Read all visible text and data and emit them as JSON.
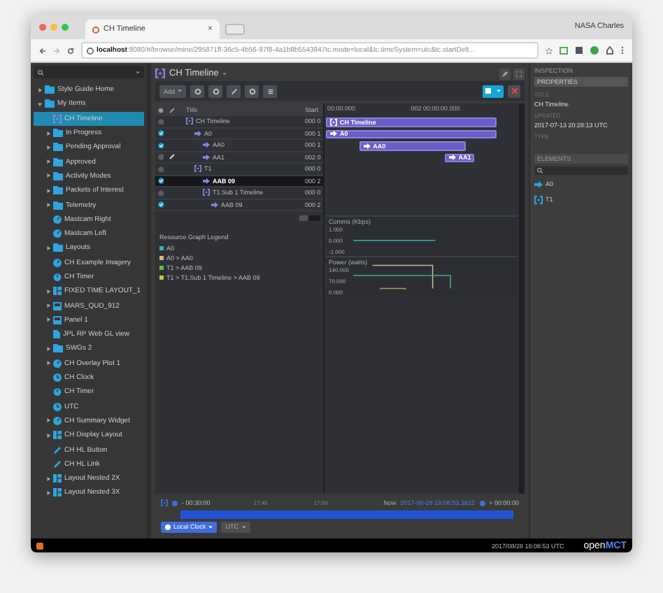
{
  "browser": {
    "tab_title": "CH Timeline",
    "tab_close": "×",
    "profile": "NASA Charles",
    "url_host": "localhost",
    "url_rest": ":8080/#/browse/mine/295871ff-36c5-4b56-97f8-4a1b8b5543947tc.mode=local&tc.timeSystem=utc&tc.startDelt..."
  },
  "sidebar": {
    "items": [
      {
        "label": "Style Guide Home",
        "kind": "folder",
        "expanded": false,
        "selected": false
      },
      {
        "label": "My Items",
        "kind": "folder",
        "expanded": true,
        "selected": false,
        "children": [
          {
            "label": "CH Timeline",
            "kind": "timeline",
            "selected": true
          },
          {
            "label": "In Progress",
            "kind": "folder",
            "expanded": false,
            "selected": false
          },
          {
            "label": "Pending Approval",
            "kind": "folder",
            "expanded": false,
            "selected": false
          },
          {
            "label": "Approved",
            "kind": "folder",
            "expanded": false,
            "selected": false
          },
          {
            "label": "Activity Modes",
            "kind": "folder",
            "expanded": false,
            "selected": false
          },
          {
            "label": "Packets of Interest",
            "kind": "folder",
            "expanded": false,
            "selected": false
          },
          {
            "label": "Telemetry",
            "kind": "folder",
            "expanded": false,
            "selected": false
          },
          {
            "label": "Mastcam Right",
            "kind": "telemetry",
            "selected": false
          },
          {
            "label": "Mastcam Left",
            "kind": "telemetry",
            "selected": false
          },
          {
            "label": "Layouts",
            "kind": "folder",
            "expanded": false,
            "selected": false
          },
          {
            "label": "CH Example Imagery",
            "kind": "telemetry",
            "selected": false
          },
          {
            "label": "CH Timer",
            "kind": "timer",
            "selected": false
          },
          {
            "label": "FIXED TIME LAYOUT_1",
            "kind": "layout",
            "expanded": false,
            "selected": false
          },
          {
            "label": "MARS_QUD_912",
            "kind": "panel",
            "expanded": false,
            "selected": false
          },
          {
            "label": "Panel 1",
            "kind": "panel",
            "expanded": false,
            "selected": false
          },
          {
            "label": "JPL RP Web GL view",
            "kind": "document",
            "selected": false
          },
          {
            "label": "SWGs 2",
            "kind": "folder",
            "expanded": false,
            "selected": false
          },
          {
            "label": "CH Overlay Plot 1",
            "kind": "telemetry",
            "expanded": false,
            "selected": false
          },
          {
            "label": "CH Clock",
            "kind": "clock",
            "selected": false
          },
          {
            "label": "CH Timer",
            "kind": "timer",
            "selected": false
          },
          {
            "label": "UTC",
            "kind": "clock",
            "selected": false
          },
          {
            "label": "CH Summary Widget",
            "kind": "telemetry",
            "expanded": false,
            "selected": false
          },
          {
            "label": "CH Display Layout",
            "kind": "layout",
            "expanded": false,
            "selected": false
          },
          {
            "label": "CH HL Button",
            "kind": "link",
            "selected": false
          },
          {
            "label": "CH HL Link",
            "kind": "link",
            "selected": false
          },
          {
            "label": "Layout Nested 2X",
            "kind": "layout",
            "expanded": false,
            "selected": false
          },
          {
            "label": "Layout Nested 3X",
            "kind": "layout",
            "expanded": false,
            "selected": false
          }
        ]
      }
    ]
  },
  "main": {
    "title": "CH Timeline",
    "add_label": "Add",
    "table": {
      "columns": [
        "Title",
        "Start"
      ],
      "rows": [
        {
          "title": "CH Timeline",
          "kind": "timeline",
          "start": "000 0",
          "checked": false,
          "linked": false,
          "selected": false,
          "children": [
            {
              "title": "A0",
              "kind": "activity",
              "start": "000 1",
              "checked": true,
              "linked": false,
              "selected": false,
              "children": [
                {
                  "title": "AA0",
                  "kind": "activity",
                  "start": "000 1",
                  "checked": true,
                  "linked": false,
                  "selected": false
                },
                {
                  "title": "AA1",
                  "kind": "activity",
                  "start": "002 0",
                  "checked": false,
                  "linked": true,
                  "selected": false
                }
              ]
            },
            {
              "title": "T1",
              "kind": "timeline",
              "start": "000 0",
              "checked": false,
              "linked": false,
              "selected": false,
              "children": [
                {
                  "title": "AAB 09",
                  "kind": "activity",
                  "start": "000 2",
                  "checked": true,
                  "linked": false,
                  "selected": true
                },
                {
                  "title": "T1.Sub 1 Timeline",
                  "kind": "timeline",
                  "start": "000 0",
                  "checked": false,
                  "linked": false,
                  "selected": false,
                  "children": [
                    {
                      "title": "AAB 09",
                      "kind": "activity",
                      "start": "000 2",
                      "checked": true,
                      "linked": false,
                      "selected": false
                    }
                  ]
                }
              ]
            }
          ]
        }
      ]
    },
    "legend": {
      "title": "Resource Graph Legend",
      "items": [
        {
          "label": "A0",
          "color": "#2cb8b0"
        },
        {
          "label": "A0 > AA0",
          "color": "#e0b070"
        },
        {
          "label": "T1 > AAB 09",
          "color": "#58c840"
        },
        {
          "label": "T1 > T1.Sub 1 Timeline > AAB 09",
          "color": "#b8d030"
        }
      ]
    },
    "gantt": {
      "ticks": [
        "00:00.000",
        "002 00:00:00.000"
      ],
      "bars": [
        {
          "label": "CH Timeline",
          "kind": "timeline"
        },
        {
          "label": "A0",
          "kind": "activity"
        },
        {
          "label": "AA0",
          "kind": "activity"
        },
        {
          "label": "AA1",
          "kind": "activity"
        }
      ]
    },
    "graphs": [
      {
        "title": "Comms (Kbps)",
        "ticks": [
          "1.000",
          "0.000",
          "-1.000"
        ]
      },
      {
        "title": "Power (watts)",
        "ticks": [
          "140.000",
          "70.000",
          "0.000"
        ]
      }
    ],
    "conductor": {
      "start": "- 00:30:00",
      "ticks": [
        "17:45",
        "17:50"
      ],
      "now_label": "Now",
      "now": "2017-08-28 18:08:53.382Z",
      "end": "+ 00:00:00",
      "clock": "Local Clock",
      "time_system": "UTC"
    }
  },
  "inspector": {
    "heading": "INSPECTION",
    "tab": "PROPERTIES",
    "fields": [
      {
        "label": "TITLE",
        "value": "CH Timeline"
      },
      {
        "label": "UPDATED",
        "value": "2017-07-13 20:28:13 UTC"
      },
      {
        "label": "TYPE"
      }
    ],
    "elements_heading": "ELEMENTS",
    "elements": [
      {
        "label": "A0",
        "kind": "activity"
      },
      {
        "label": "T1",
        "kind": "timeline"
      }
    ]
  },
  "footer": {
    "timestamp": "2017/08/28 18:08:53 UTC",
    "logo_open": "open",
    "logo_mct": "MCT"
  }
}
